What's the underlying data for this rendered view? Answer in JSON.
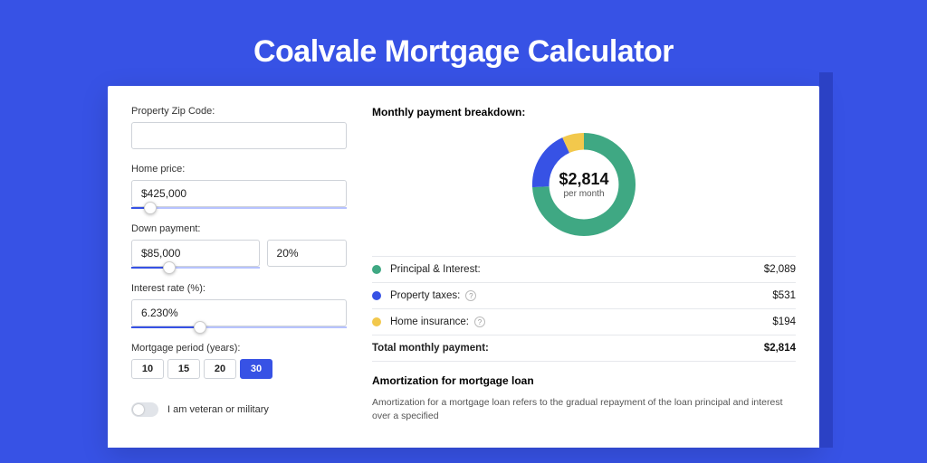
{
  "hero": {
    "title": "Coalvale Mortgage Calculator"
  },
  "form": {
    "zip": {
      "label": "Property Zip Code:",
      "value": ""
    },
    "price": {
      "label": "Home price:",
      "value": "$425,000",
      "slider_pct": 9
    },
    "down": {
      "label": "Down payment:",
      "amount": "$85,000",
      "percent": "20%",
      "slider_pct": 30
    },
    "rate": {
      "label": "Interest rate (%):",
      "value": "6.230%",
      "slider_pct": 32
    },
    "period": {
      "label": "Mortgage period (years):",
      "options": [
        "10",
        "15",
        "20",
        "30"
      ],
      "selected": "30"
    },
    "veteran": {
      "label": "I am veteran or military",
      "on": false
    }
  },
  "breakdown": {
    "title": "Monthly payment breakdown:",
    "center_value": "$2,814",
    "center_sub": "per month",
    "items": [
      {
        "name": "Principal & Interest:",
        "value": "$2,089",
        "color": "#3fa883",
        "info": false,
        "pct": 74
      },
      {
        "name": "Property taxes:",
        "value": "$531",
        "color": "#3752e5",
        "info": true,
        "pct": 19
      },
      {
        "name": "Home insurance:",
        "value": "$194",
        "color": "#f2c84c",
        "info": true,
        "pct": 7
      }
    ],
    "total": {
      "name": "Total monthly payment:",
      "value": "$2,814"
    }
  },
  "amortization": {
    "title": "Amortization for mortgage loan",
    "body": "Amortization for a mortgage loan refers to the gradual repayment of the loan principal and interest over a specified"
  },
  "chart_data": {
    "type": "pie",
    "title": "Monthly payment breakdown",
    "series": [
      {
        "name": "Principal & Interest",
        "value": 2089,
        "color": "#3fa883"
      },
      {
        "name": "Property taxes",
        "value": 531,
        "color": "#3752e5"
      },
      {
        "name": "Home insurance",
        "value": 194,
        "color": "#f2c84c"
      }
    ],
    "total": 2814,
    "center_label": "$2,814 per month"
  }
}
